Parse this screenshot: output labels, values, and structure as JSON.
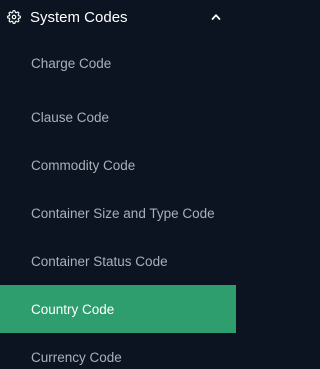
{
  "sidebar": {
    "group": {
      "title": "System Codes",
      "icon": "gear-icon",
      "expanded": true,
      "chevron_icon": "chevron-up-icon"
    },
    "items": [
      {
        "label": "Charge Code",
        "active": false
      },
      {
        "label": "Clause Code",
        "active": false
      },
      {
        "label": "Commodity Code",
        "active": false
      },
      {
        "label": "Container Size and Type Code",
        "active": false
      },
      {
        "label": "Container Status Code",
        "active": false
      },
      {
        "label": "Country Code",
        "active": true
      },
      {
        "label": "Currency Code",
        "active": false
      }
    ]
  },
  "colors": {
    "background": "#0b1420",
    "active_background": "#2e9e6f",
    "active_text": "#ffffff",
    "inactive_text": "#a8b0b9",
    "header_text": "#ffffff"
  }
}
